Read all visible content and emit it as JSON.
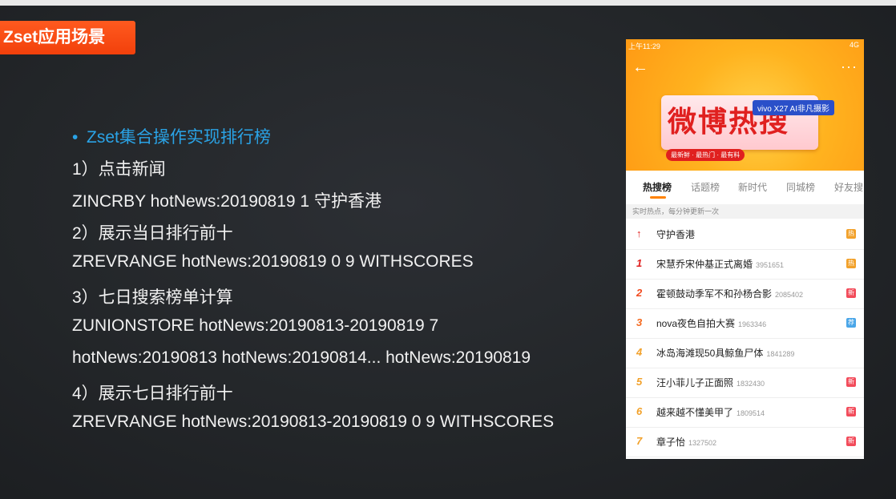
{
  "slide": {
    "title": "Zset应用场景",
    "heading": "Zset集合操作实现排行榜",
    "lines": [
      "1）点击新闻",
      "ZINCRBY  hotNews:20190819  1  守护香港",
      "2）展示当日排行前十",
      "ZREVRANGE  hotNews:20190819  0  9  WITHSCORES",
      "3）七日搜索榜单计算",
      "ZUNIONSTORE  hotNews:20190813-20190819  7",
      "hotNews:20190813  hotNews:20190814... hotNews:20190819",
      "4）展示七日排行前十",
      "ZREVRANGE hotNews:20190813-20190819  0  9  WITHSCORES"
    ]
  },
  "phone": {
    "status_time": "上午11:29",
    "status_right": "4G",
    "banner": {
      "logo_text": "微博热搜",
      "logo_tagline": "最新鲜 · 最热门 · 最有料",
      "brand_badge": "vivo X27 AI非凡摄影"
    },
    "tabs": [
      "热搜榜",
      "话题榜",
      "新时代",
      "同城榜",
      "好友搜"
    ],
    "subheader": "实时热点，每分钟更新一次",
    "rows": [
      {
        "rank": "",
        "title": "守护香港",
        "count": "",
        "badge": "热",
        "badge_color": "#f2a12a",
        "rank_color": "#e0201f"
      },
      {
        "rank": "1",
        "title": "宋慧乔宋仲基正式离婚",
        "count": "3951651",
        "badge": "热",
        "badge_color": "#f2a12a",
        "rank_color": "#e0201f"
      },
      {
        "rank": "2",
        "title": "霍顿鼓动季军不和孙杨合影",
        "count": "2085402",
        "badge": "新",
        "badge_color": "#f24b5a",
        "rank_color": "#f24b1f"
      },
      {
        "rank": "3",
        "title": "nova夜色自拍大赛",
        "count": "1963346",
        "badge": "荐",
        "badge_color": "#4aa6e8",
        "rank_color": "#f56a1f"
      },
      {
        "rank": "4",
        "title": "冰岛海滩现50具鲸鱼尸体",
        "count": "1841289",
        "badge": "",
        "badge_color": "",
        "rank_color": "#f2a12a"
      },
      {
        "rank": "5",
        "title": "汪小菲儿子正面照",
        "count": "1832430",
        "badge": "新",
        "badge_color": "#f24b5a",
        "rank_color": "#f2a12a"
      },
      {
        "rank": "6",
        "title": "越来越不懂美甲了",
        "count": "1809514",
        "badge": "新",
        "badge_color": "#f24b5a",
        "rank_color": "#f2a12a"
      },
      {
        "rank": "7",
        "title": "章子怡",
        "count": "1327502",
        "badge": "新",
        "badge_color": "#f24b5a",
        "rank_color": "#f2a12a"
      }
    ]
  }
}
